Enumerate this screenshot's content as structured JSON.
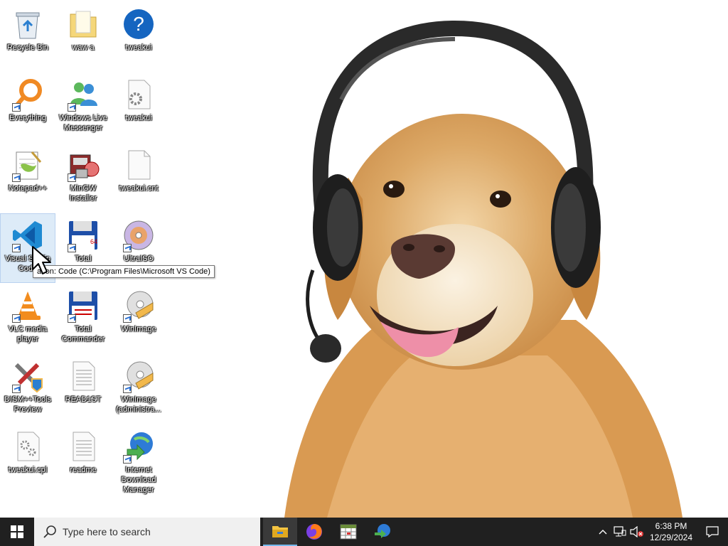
{
  "desktop": {
    "icons": [
      {
        "label": "Recycle Bin",
        "icon": "recycle-bin-icon"
      },
      {
        "label": "waw a",
        "icon": "folder-icon"
      },
      {
        "label": "tweakui",
        "icon": "help-icon"
      },
      {
        "label": "Everything",
        "icon": "search-magnifier-icon"
      },
      {
        "label": "Windows Live Messenger",
        "icon": "messenger-icon"
      },
      {
        "label": "tweakui",
        "icon": "settings-file-icon"
      },
      {
        "label": "Notepad++",
        "icon": "notepadpp-icon"
      },
      {
        "label": "MinGW Installer",
        "icon": "installer-icon"
      },
      {
        "label": "tweakui.cnt",
        "icon": "blank-file-icon"
      },
      {
        "label": "Visual Studio Code",
        "icon": "vscode-icon"
      },
      {
        "label": "Total",
        "icon": "floppy-icon"
      },
      {
        "label": "UltraISO",
        "icon": "disc-icon"
      },
      {
        "label": "VLC media player",
        "icon": "vlc-icon"
      },
      {
        "label": "Total Commander",
        "icon": "floppy-icon"
      },
      {
        "label": "WinImage",
        "icon": "winimage-icon"
      },
      {
        "label": "DISM++Tools Preview",
        "icon": "tools-icon"
      },
      {
        "label": "READ1ST",
        "icon": "text-file-icon"
      },
      {
        "label": "WinImage (administra...",
        "icon": "winimage-icon"
      },
      {
        "label": "tweakui.cpl",
        "icon": "control-panel-icon"
      },
      {
        "label": "readme",
        "icon": "text-file-icon"
      },
      {
        "label": "Internet Download Manager",
        "icon": "idm-icon"
      }
    ],
    "tooltip": "Location: Code (C:\\Program Files\\Microsoft VS Code)",
    "tooltip_visible": "ation: Code (C:\\Program Files\\Microsoft VS Code)"
  },
  "taskbar": {
    "search_placeholder": "Type here to search",
    "apps": [
      "file-explorer-icon",
      "firefox-icon",
      "spreadsheet-app-icon",
      "idm-icon"
    ],
    "clock_time": "6:38 PM",
    "clock_date": "12/29/2024"
  },
  "colors": {
    "taskbar_bg": "#202020",
    "search_bg": "#f0f0f0",
    "accent": "#76b9ed"
  }
}
